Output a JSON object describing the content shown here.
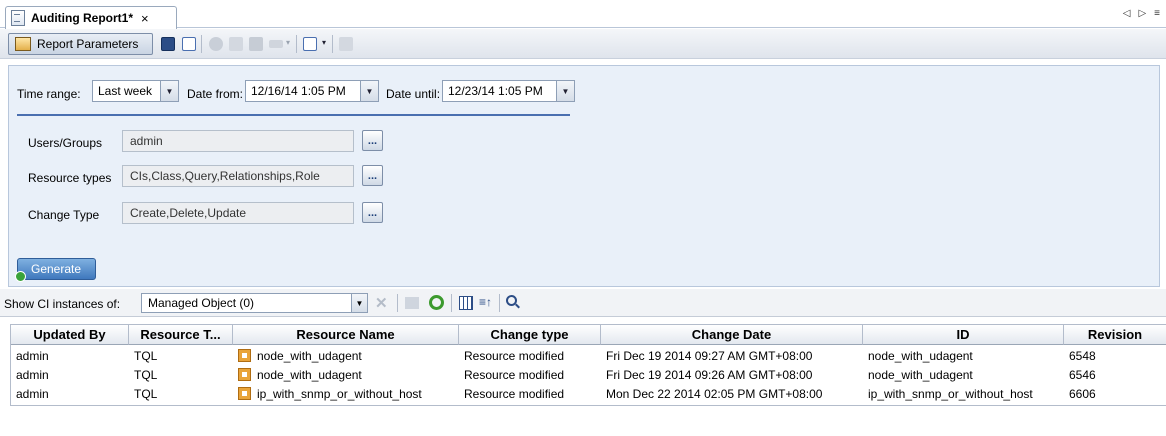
{
  "tab": {
    "title": "Auditing Report1*",
    "close": "×"
  },
  "tabnav": {
    "left": "◁",
    "right": "▷",
    "menu": "≡"
  },
  "toolbar": {
    "report_parameters": "Report Parameters"
  },
  "params": {
    "time_range_label": "Time range:",
    "time_range_value": "Last week",
    "date_from_label": "Date from:",
    "date_from_value": "12/16/14 1:05 PM",
    "date_until_label": "Date until:",
    "date_until_value": "12/23/14 1:05 PM",
    "users_label": "Users/Groups",
    "users_value": "admin",
    "resource_types_label": "Resource types",
    "resource_types_value": "CIs,Class,Query,Relationships,Role",
    "change_type_label": "Change Type",
    "change_type_value": "Create,Delete,Update",
    "ellipsis": "...",
    "generate": "Generate"
  },
  "ci_bar": {
    "label": "Show CI instances of:",
    "value": "Managed Object (0)"
  },
  "table": {
    "columns": [
      "Updated By",
      "Resource T...",
      "Resource Name",
      "Change type",
      "Change Date",
      "ID",
      "Revision"
    ],
    "rows": [
      [
        "admin",
        "TQL",
        "node_with_udagent",
        "Resource modified",
        "Fri Dec 19 2014 09:27 AM GMT+08:00",
        "node_with_udagent",
        "6548"
      ],
      [
        "admin",
        "TQL",
        "node_with_udagent",
        "Resource modified",
        "Fri Dec 19 2014 09:26 AM GMT+08:00",
        "node_with_udagent",
        "6546"
      ],
      [
        "admin",
        "TQL",
        "ip_with_snmp_or_without_host",
        "Resource modified",
        "Mon Dec 22 2014 02:05 PM GMT+08:00",
        "ip_with_snmp_or_without_host",
        "6606"
      ]
    ]
  },
  "colors": {
    "panel_bg": "#e9f0f9",
    "accent": "#4a6fb0",
    "generate_bg": "#3f78bd"
  }
}
